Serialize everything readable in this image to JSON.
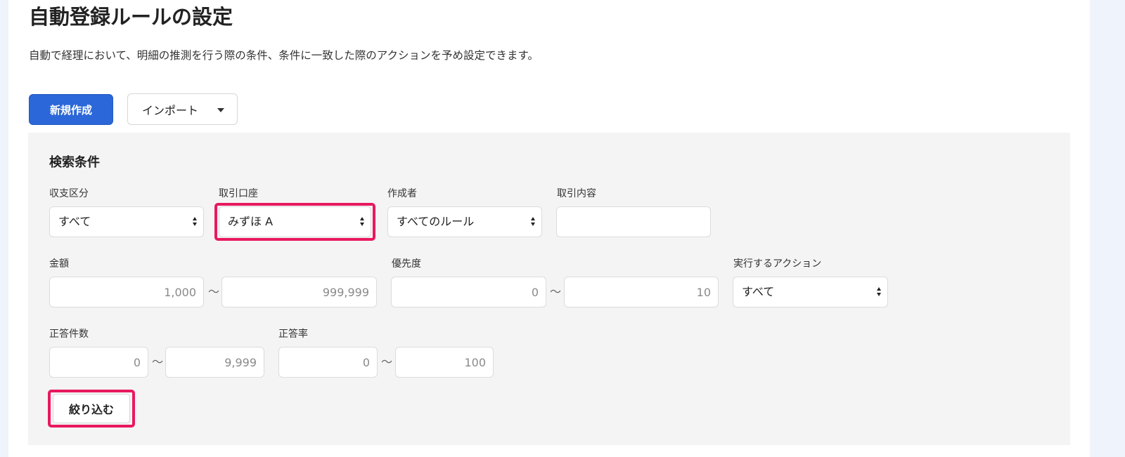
{
  "page": {
    "title": "自動登録ルールの設定",
    "description": "自動で経理において、明細の推測を行う際の条件、条件に一致した際のアクションを予め設定できます。"
  },
  "toolbar": {
    "new_label": "新規作成",
    "import_label": "インポート"
  },
  "search": {
    "title": "検索条件",
    "income_expense": {
      "label": "収支区分",
      "value": "すべて"
    },
    "account": {
      "label": "取引口座",
      "value": "みずほ A"
    },
    "creator": {
      "label": "作成者",
      "value": "すべてのルール"
    },
    "content": {
      "label": "取引内容",
      "placeholder": ""
    },
    "amount": {
      "label": "金額",
      "min_placeholder": "1,000",
      "max_placeholder": "999,999"
    },
    "priority": {
      "label": "優先度",
      "min_placeholder": "0",
      "max_placeholder": "10"
    },
    "action": {
      "label": "実行するアクション",
      "value": "すべて"
    },
    "correct_count": {
      "label": "正答件数",
      "min_placeholder": "0",
      "max_placeholder": "9,999"
    },
    "correct_rate": {
      "label": "正答率",
      "min_placeholder": "0",
      "max_placeholder": "100"
    },
    "range_separator": "〜",
    "filter_label": "絞り込む"
  },
  "colors": {
    "primary": "#2b67d8",
    "highlight": "#e8195f",
    "panel_bg": "#f5f4f4",
    "outer_bg": "#eef3fc"
  }
}
